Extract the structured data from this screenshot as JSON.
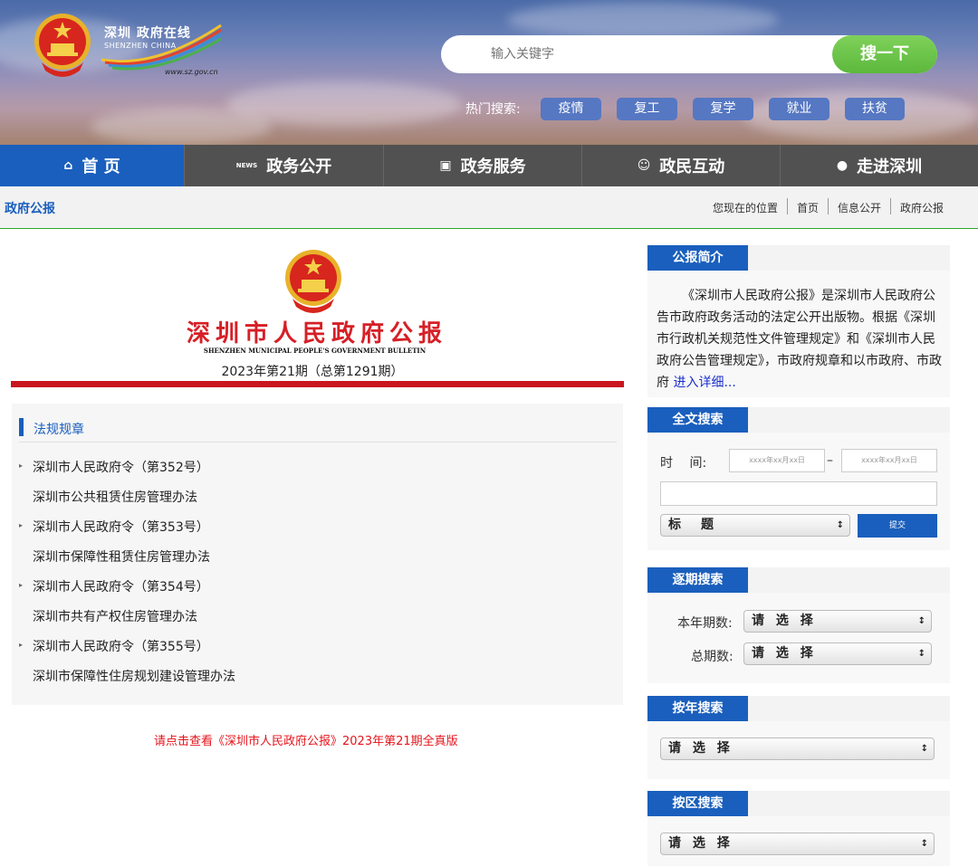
{
  "header": {
    "logo_cn": "深圳 政府在线",
    "logo_en": "SHENZHEN CHINA",
    "logo_url": "www.sz.gov.cn",
    "search_placeholder": "输入关键字",
    "search_button": "搜一下",
    "hot_label": "热门搜索:",
    "hot_tags": [
      "疫情",
      "复工",
      "复学",
      "就业",
      "扶贫"
    ]
  },
  "nav": {
    "items": [
      {
        "label": "首 页",
        "icon": "home-icon"
      },
      {
        "label": "政务公开",
        "icon": "news-icon"
      },
      {
        "label": "政务服务",
        "icon": "monitor-icon"
      },
      {
        "label": "政民互动",
        "icon": "users-icon"
      },
      {
        "label": "走进深圳",
        "icon": "chat-icon"
      }
    ]
  },
  "breadcrumb": {
    "title": "政府公报",
    "location_label": "您现在的位置",
    "path": [
      "首页",
      "信息公开",
      "政府公报"
    ]
  },
  "bulletin": {
    "title": "深圳市人民政府公报",
    "title_en": "SHENZHEN MUNICIPAL PEOPLE'S GOVERNMENT BULLETIN",
    "issue": "2023年第21期（总第1291期）"
  },
  "regulations": {
    "heading": "法规规章",
    "items": [
      {
        "text": "深圳市人民政府令（第352号）",
        "arrow": true
      },
      {
        "text": "深圳市公共租赁住房管理办法",
        "arrow": false
      },
      {
        "text": "深圳市人民政府令（第353号）",
        "arrow": true
      },
      {
        "text": "深圳市保障性租赁住房管理办法",
        "arrow": false
      },
      {
        "text": "深圳市人民政府令（第354号）",
        "arrow": true
      },
      {
        "text": "深圳市共有产权住房管理办法",
        "arrow": false
      },
      {
        "text": "深圳市人民政府令（第355号）",
        "arrow": true
      },
      {
        "text": "深圳市保障性住房规划建设管理办法",
        "arrow": false
      }
    ]
  },
  "full_version_link": "请点击查看《深圳市人民政府公报》2023年第21期全真版",
  "sidebar": {
    "intro": {
      "heading": "公报简介",
      "text": "《深圳市人民政府公报》是深圳市人民政府公告市政府政务活动的法定公开出版物。根据《深圳市行政机关规范性文件管理规定》和《深圳市人民政府公告管理规定》，市政府规章和以市政府、市政府 ",
      "more": "进入详细..."
    },
    "fulltext": {
      "heading": "全文搜索",
      "time_label": "时　 间:",
      "date_placeholder": "xxxx年xx月xx日",
      "dash": "–",
      "field_select": "标　题",
      "submit": "提交"
    },
    "issue_search": {
      "heading": "逐期搜索",
      "year_label": "本年期数:",
      "total_label": "总期数:",
      "select_placeholder": "请 选 择"
    },
    "year_search": {
      "heading": "按年搜索",
      "select_placeholder": "请 选 择"
    },
    "district_search": {
      "heading": "按区搜索",
      "select_placeholder": "请 选 择"
    }
  }
}
